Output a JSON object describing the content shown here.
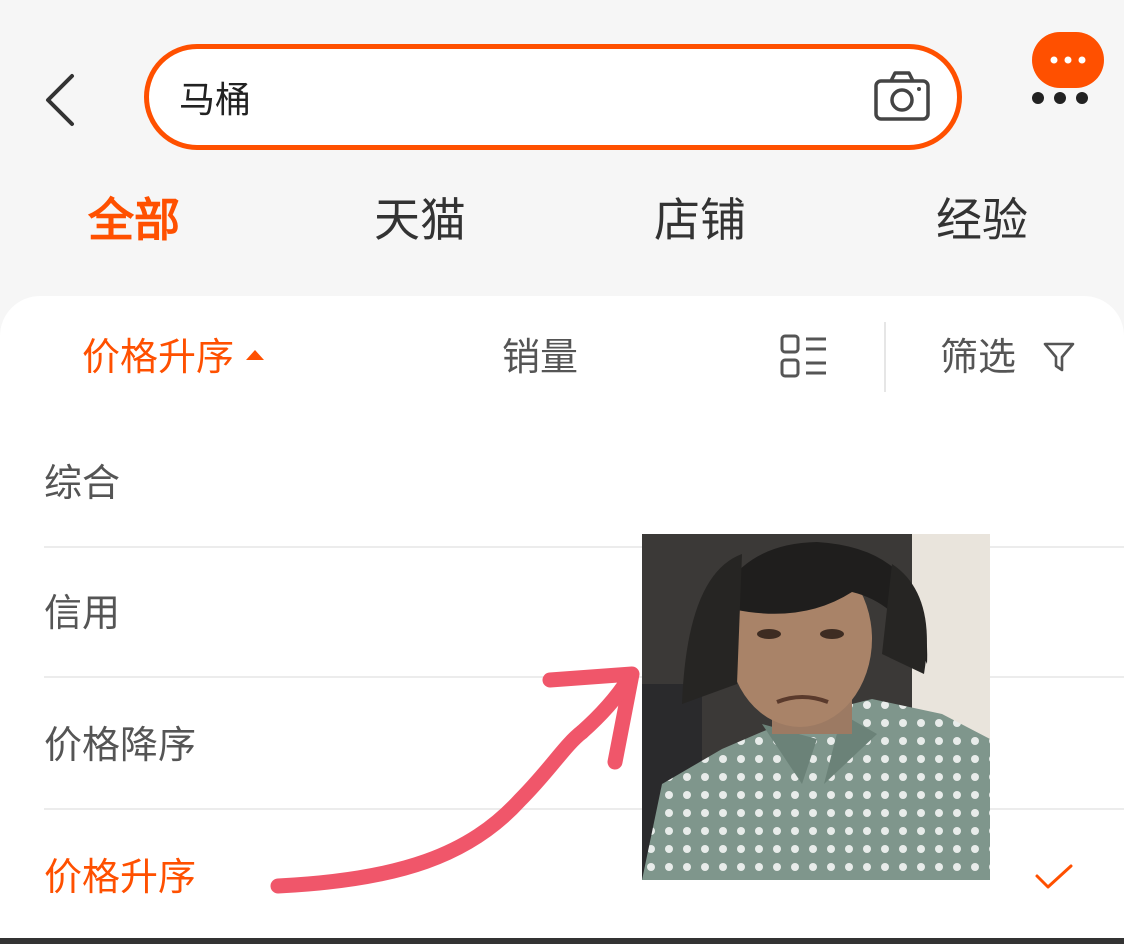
{
  "header": {
    "search_query": "马桶",
    "back_icon": "chevron-left-icon",
    "camera_icon": "camera-icon",
    "message_icon": "message-bubble-icon",
    "more_icon": "more-dots-icon",
    "accent_color": "#ff5000"
  },
  "tabs": [
    {
      "label": "全部",
      "active": true
    },
    {
      "label": "天猫",
      "active": false
    },
    {
      "label": "店铺",
      "active": false
    },
    {
      "label": "经验",
      "active": false
    }
  ],
  "sortbar": {
    "price_sort_label": "价格升序",
    "sales_label": "销量",
    "layout_icon": "list-view-icon",
    "filter_label": "筛选",
    "filter_icon": "funnel-icon"
  },
  "sort_options": [
    {
      "label": "综合",
      "selected": false
    },
    {
      "label": "信用",
      "selected": false
    },
    {
      "label": "价格降序",
      "selected": false
    },
    {
      "label": "价格升序",
      "selected": true
    }
  ],
  "overlay": {
    "image": "photo of a woman with a frowning expression",
    "arrow_color": "#f0566a"
  }
}
